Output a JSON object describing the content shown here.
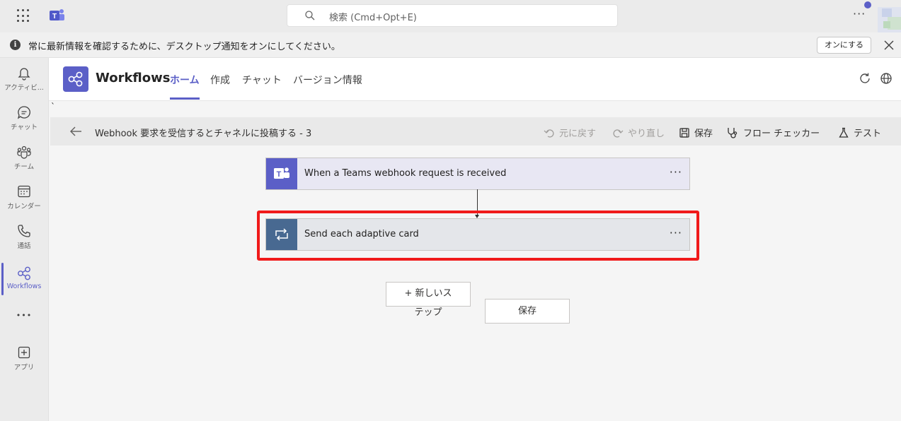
{
  "titlebar": {
    "search_placeholder": "検索 (Cmd+Opt+E)"
  },
  "notification": {
    "message": "常に最新情報を確認するために、デスクトップ通知をオンにしてください。",
    "turn_on_label": "オンにする",
    "info_glyph": "i"
  },
  "rail": {
    "activity": "アクティビ...",
    "chat": "チャット",
    "teams": "チーム",
    "calendar": "カレンダー",
    "calls": "通話",
    "workflows": "Workflows",
    "more": "•••",
    "apps": "アプリ"
  },
  "app": {
    "name": "Workflows",
    "tabs": [
      "ホーム",
      "作成",
      "チャット",
      "バージョン情報"
    ],
    "stray_char": "`"
  },
  "command_bar": {
    "flow_title": "Webhook 要求を受信するとチャネルに投稿する - 3",
    "undo": "元に戻す",
    "redo": "やり直し",
    "save": "保存",
    "flow_checker": "フロー チェッカー",
    "test": "テスト"
  },
  "flow": {
    "steps": [
      {
        "title": "When a Teams webhook request is received",
        "icon": "teams-icon"
      },
      {
        "title": "Send each adaptive card",
        "icon": "loop-icon"
      }
    ],
    "more_glyph": "···",
    "new_step_label": "+ 新しいステップ",
    "save_label": "保存"
  },
  "colors": {
    "accent": "#5b5fc7",
    "highlight": "#f01a1a",
    "loop_icon_bg": "#486991"
  }
}
